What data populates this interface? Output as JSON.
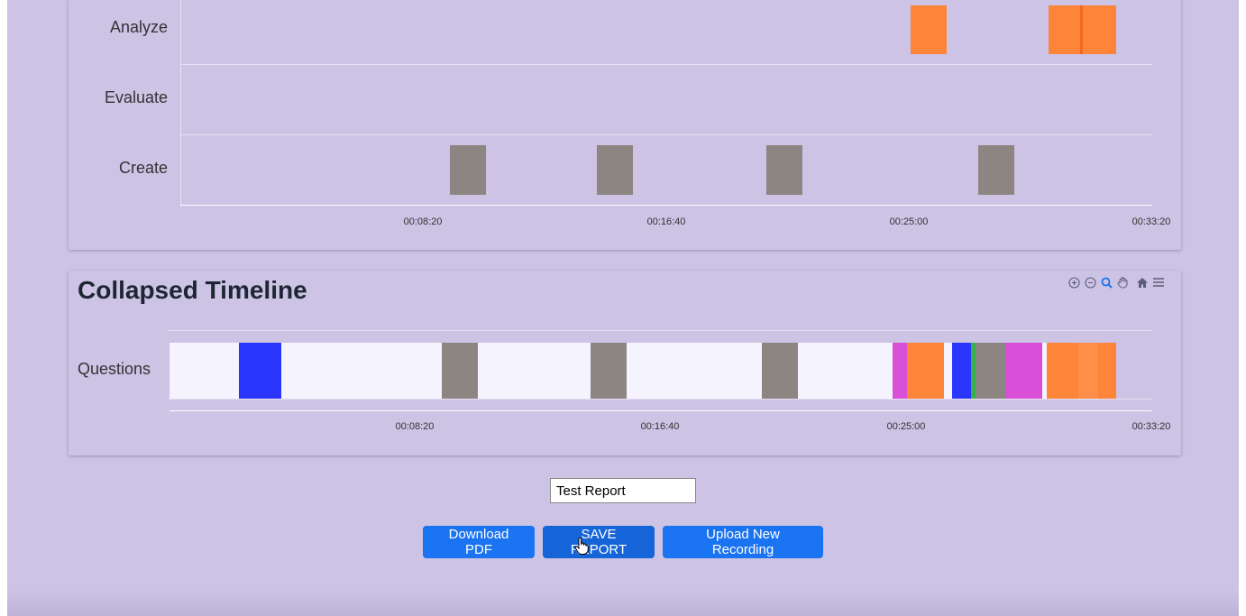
{
  "top_timeline": {
    "rows": [
      {
        "label": "Analyze"
      },
      {
        "label": "Evaluate"
      },
      {
        "label": "Create"
      }
    ],
    "ticks": [
      "00:08:20",
      "00:16:40",
      "00:25:00",
      "00:33:20"
    ]
  },
  "collapsed_timeline": {
    "title": "Collapsed Timeline",
    "row_label": "Questions",
    "ticks": [
      "00:08:20",
      "00:16:40",
      "00:25:00",
      "00:33:20"
    ]
  },
  "colors": {
    "orange": "#fd8438",
    "gray": "#8c8582",
    "blue": "#2a36fb",
    "magenta": "#da4fd7",
    "green": "#35b34a",
    "white_bar": "#f5f3fd",
    "button": "#1a73f0"
  },
  "toolbar": {
    "icons": [
      "zoom-in-icon",
      "zoom-out-icon",
      "zoom-selection-icon",
      "pan-icon",
      "home-icon",
      "menu-icon"
    ]
  },
  "report": {
    "name_value": "Test Report"
  },
  "buttons": {
    "download_pdf": "Download PDF",
    "save_report": "SAVE REPORT",
    "upload_new": "Upload New Recording"
  }
}
